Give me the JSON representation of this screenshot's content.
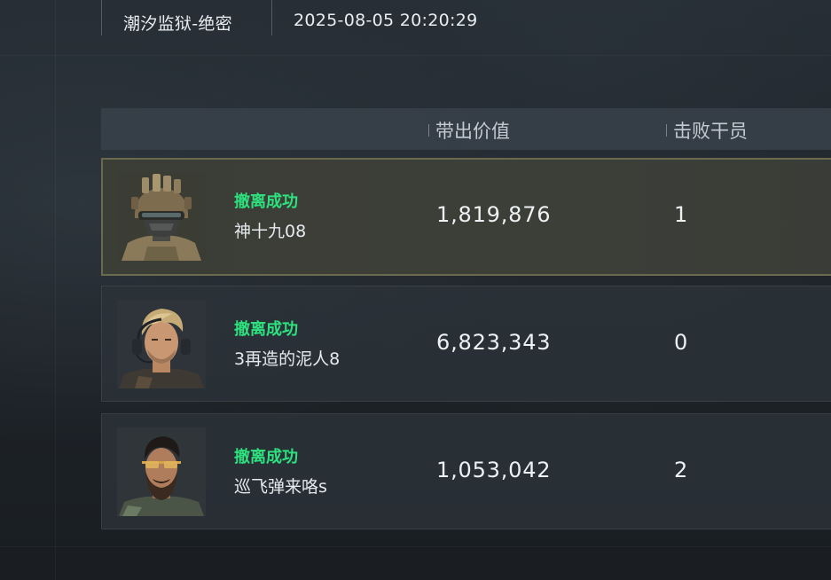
{
  "match_info": {
    "map_label": "",
    "map_value": "潮汐监狱-绝密",
    "time_label": "",
    "time_value": "2025-08-05 20:20:29"
  },
  "table": {
    "columns": {
      "value": "带出价值",
      "kills": "击败干员"
    },
    "rows": [
      {
        "status": "撤离成功",
        "player": "神十九08",
        "value": "1,819,876",
        "kills": "1",
        "portrait_icon": "helmet-operator-portrait",
        "highlighted": true
      },
      {
        "status": "撤离成功",
        "player": "3再造的泥人8",
        "value": "6,823,343",
        "kills": "0",
        "portrait_icon": "blonde-headset-operator-portrait",
        "highlighted": false
      },
      {
        "status": "撤离成功",
        "player": "巡飞弹来咯s",
        "value": "1,053,042",
        "kills": "2",
        "portrait_icon": "bearded-glasses-operator-portrait",
        "highlighted": false
      }
    ]
  },
  "colors": {
    "success_green": "#2ee07e",
    "highlight_border": "#6b6a4e",
    "background": "#1b2025"
  }
}
